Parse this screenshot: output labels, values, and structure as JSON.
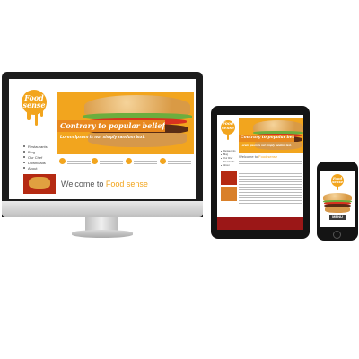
{
  "brand": {
    "logo_line1": "Food",
    "logo_line2": "sense"
  },
  "banner": {
    "headline": "Contrary to popular belief,",
    "subline": "Lorem Ipsum is not simply random text."
  },
  "nav_items": [
    "Restaurants",
    "Blog",
    "Our Chef",
    "Downloads",
    "About"
  ],
  "welcome": {
    "prefix": "Welcome to",
    "highlight": "Food sense"
  },
  "phone_menu_label": "MENU",
  "colors": {
    "accent": "#f2a51e",
    "ribbon": "#e8881e",
    "footer": "#9b1717",
    "device": "#141414"
  }
}
